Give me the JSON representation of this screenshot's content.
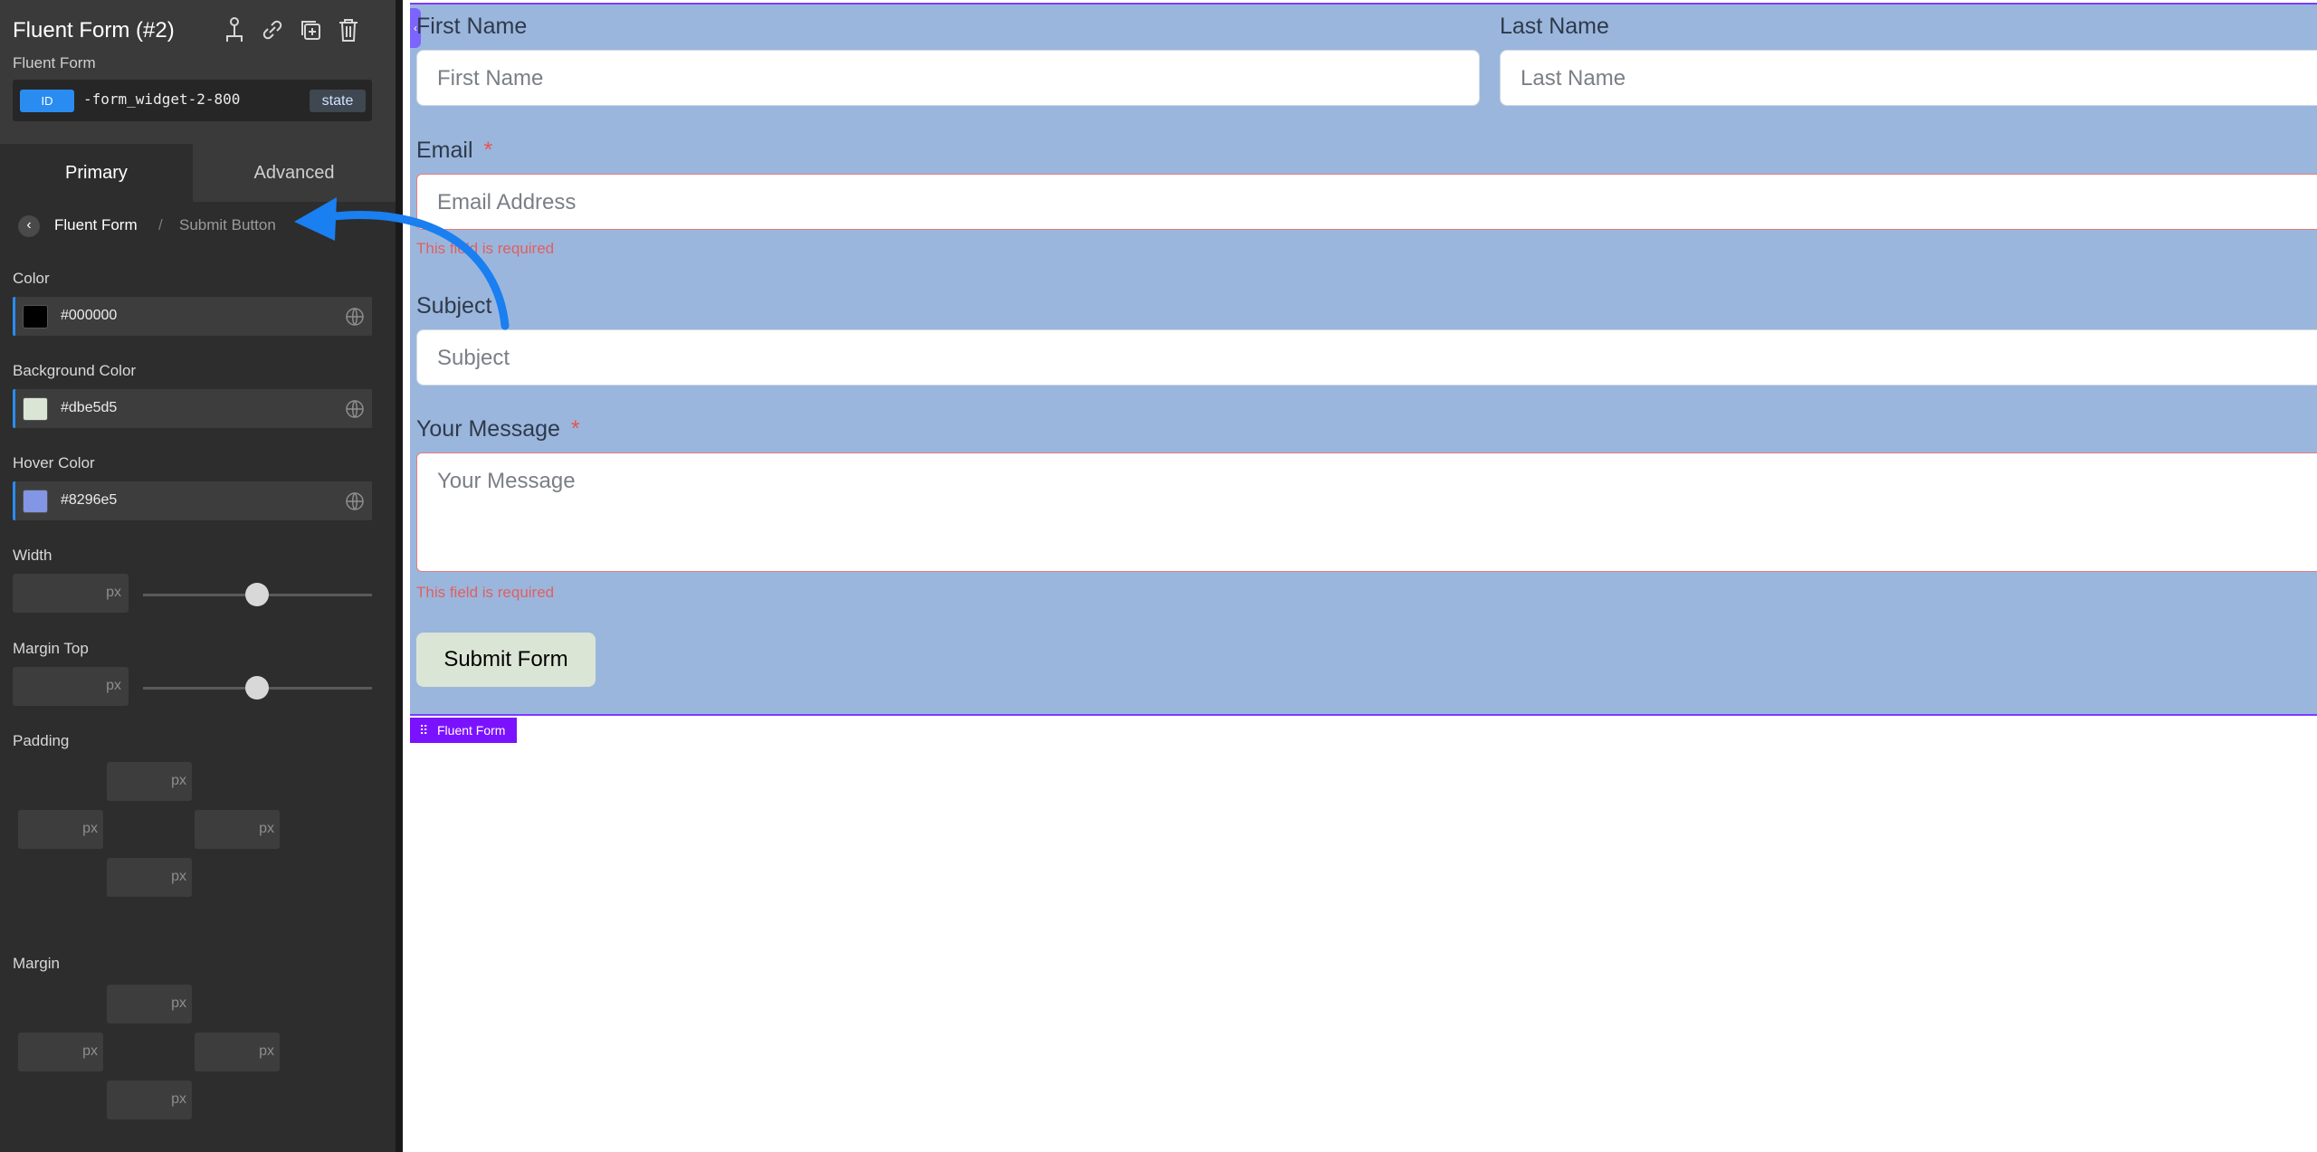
{
  "panel": {
    "title": "Fluent Form (#2)",
    "subtitle": "Fluent Form",
    "id_badge": "ID",
    "id_value": "-form_widget-2-800",
    "state_badge": "state",
    "tabs": {
      "primary": "Primary",
      "advanced": "Advanced"
    },
    "breadcrumb": {
      "back_icon": "‹",
      "parent": "Fluent Form",
      "separator": "/",
      "current": "Submit Button"
    },
    "fields": {
      "color": {
        "label": "Color",
        "value": "#000000",
        "swatch": "#000000"
      },
      "background_color": {
        "label": "Background Color",
        "value": "#dbe5d5",
        "swatch": "#dbe5d5"
      },
      "hover_color": {
        "label": "Hover Color",
        "value": "#8296e5",
        "swatch": "#8296e5"
      },
      "width": {
        "label": "Width",
        "unit": "px"
      },
      "margin_top": {
        "label": "Margin Top",
        "unit": "px"
      },
      "padding": {
        "label": "Padding",
        "unit": "px"
      },
      "margin": {
        "label": "Margin",
        "unit": "px"
      }
    }
  },
  "form": {
    "first_name": {
      "label": "First Name",
      "placeholder": "First Name"
    },
    "last_name": {
      "label": "Last Name",
      "placeholder": "Last Name"
    },
    "email": {
      "label": "Email",
      "required": "*",
      "placeholder": "Email Address",
      "error": "This field is required"
    },
    "subject": {
      "label": "Subject",
      "placeholder": "Subject"
    },
    "message": {
      "label": "Your Message",
      "required": "*",
      "placeholder": "Your Message",
      "error": "This field is required"
    },
    "submit": "Submit Form",
    "widget_tag": "Fluent Form",
    "collapse_icon": "‹"
  },
  "colors": {
    "accent": "#2a8cf0",
    "form_bg": "#9bb6dd",
    "widget_tag": "#7b12ff",
    "arrow": "#1a7ff0"
  }
}
